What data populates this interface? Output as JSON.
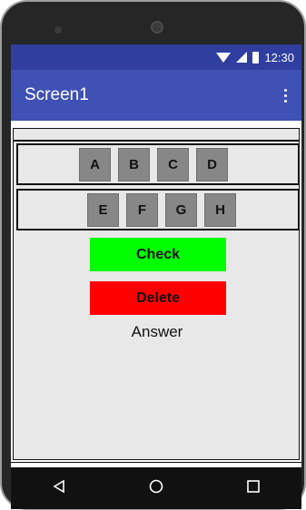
{
  "status_bar": {
    "time": "12:30",
    "icons": [
      "wifi-icon",
      "signal-icon",
      "battery-icon"
    ]
  },
  "app_bar": {
    "title": "Screen1",
    "menu_icon": "overflow-menu-icon"
  },
  "letters_row1": [
    "A",
    "B",
    "C",
    "D"
  ],
  "letters_row2": [
    "E",
    "F",
    "G",
    "H"
  ],
  "actions": {
    "check_label": "Check",
    "check_color": "#00ff00",
    "delete_label": "Delete",
    "delete_color": "#ff0000"
  },
  "answer_text": "Answer",
  "nav_bar": {
    "icons": [
      "back-icon",
      "home-icon",
      "recent-apps-icon"
    ]
  },
  "colors": {
    "status_bar": "#303f9f",
    "app_bar": "#3f51b5",
    "letter_button": "#878787"
  }
}
